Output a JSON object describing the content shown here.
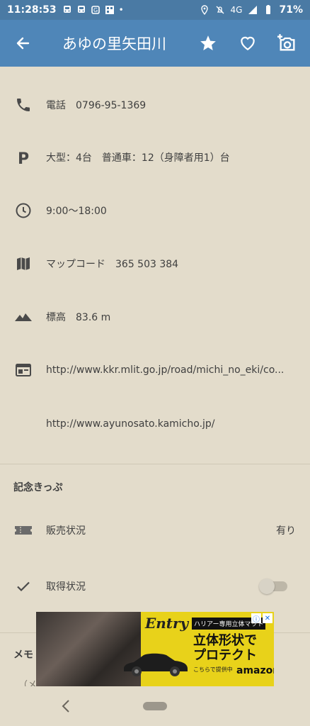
{
  "status_bar": {
    "time": "11:28:53",
    "network": "4G",
    "battery": "71%"
  },
  "app_bar": {
    "title": "あゆの里矢田川",
    "back_icon": "arrow-left-icon",
    "actions": [
      "star-icon",
      "heart-outline-icon",
      "add-photo-icon"
    ]
  },
  "details": {
    "phone": "電話　0796-95-1369",
    "parking": "大型：4台　普通車：12（身障者用1）台",
    "hours": "9:00〜18:00",
    "mapcode": "マップコード　365 503 384",
    "elevation": "標高　83.6 m",
    "url1": "http://www.kkr.mlit.go.jp/road/michi_no_eki/co...",
    "url2": "http://www.ayunosato.kamicho.jp/"
  },
  "stamp_section": {
    "heading": "記念きっぷ",
    "sales_label": "販売状況",
    "sales_value": "有り",
    "acquired_label": "取得状況",
    "acquired_toggle": false
  },
  "memo": {
    "heading": "メモ",
    "placeholder": "（メ"
  },
  "ad": {
    "brand": "Entry",
    "tag": "ハリアー専用立体マット",
    "headline_line1": "立体形状で",
    "headline_line2": "プロテクト",
    "small_text": "こちらで提供中",
    "store": "amazon"
  },
  "colors": {
    "status_bar": "#4a7aa4",
    "app_bar": "#4f86b8",
    "background": "#e3dccb",
    "ad_yellow": "#e8d21a"
  }
}
